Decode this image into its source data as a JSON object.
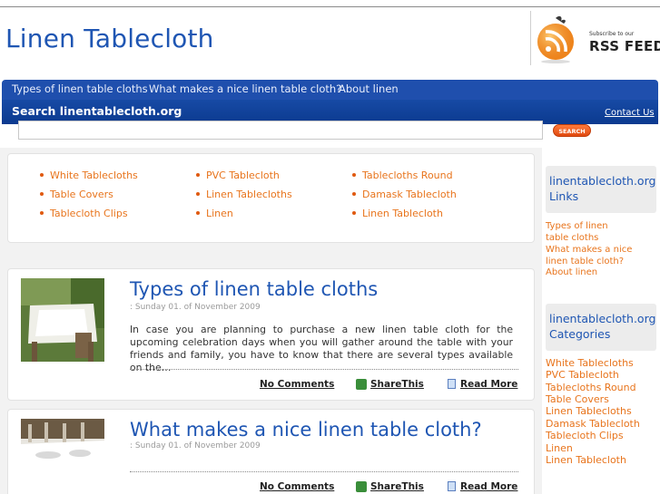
{
  "header": {
    "site_title": "Linen Tablecloth",
    "rss_subscribe": "Subscribe to our",
    "rss_feed": "RSS FEED"
  },
  "nav": {
    "items": [
      "Types of linen table cloths",
      "What makes a nice linen table cloth?",
      "About linen"
    ]
  },
  "search": {
    "title": "Search linentablecloth.org",
    "contact": "Contact Us",
    "placeholder": "",
    "button": "SEARCH"
  },
  "categories": {
    "col1": [
      "White Tablecloths",
      "Table Covers",
      "Tablecloth Clips"
    ],
    "col2": [
      "PVC Tablecloth",
      "Linen Tablecloths",
      "Linen"
    ],
    "col3": [
      "Tablecloths Round",
      "Damask Tablecloth",
      "Linen Tablecloth"
    ]
  },
  "posts": [
    {
      "title": "Types of linen table cloths",
      "date": ": Sunday 01. of November 2009",
      "excerpt": "In case you are planning to purchase a new linen table cloth for the upcoming celebration days when you will gather around the table with your friends and family, you have to know that there are several types available on the…",
      "comments": "No Comments",
      "share": "ShareThis",
      "read_more": "Read More"
    },
    {
      "title": "What makes a nice linen table cloth?",
      "date": ": Sunday 01. of November 2009",
      "excerpt": "",
      "comments": "No Comments",
      "share": "ShareThis",
      "read_more": "Read More"
    }
  ],
  "sidebar": {
    "links_heading_1": "linentablecloth.org",
    "links_heading_2": "Links",
    "links": [
      "Types of linen table cloths",
      "What makes a nice linen table cloth?",
      "About linen"
    ],
    "categories_heading_1": "linentablecloth.org",
    "categories_heading_2": "Categories",
    "categories": [
      "White Tablecloths",
      "PVC Tablecloth",
      "Tablecloths Round",
      "Table Covers",
      "Linen Tablecloths",
      "Damask Tablecloth",
      "Tablecloth Clips",
      "Linen",
      "Linen Tablecloth"
    ]
  },
  "colors": {
    "brand_blue": "#1f56b3",
    "nav_blue": "#1f4fad",
    "link_orange": "#e8741c",
    "rss_orange": "#f28a1d"
  }
}
